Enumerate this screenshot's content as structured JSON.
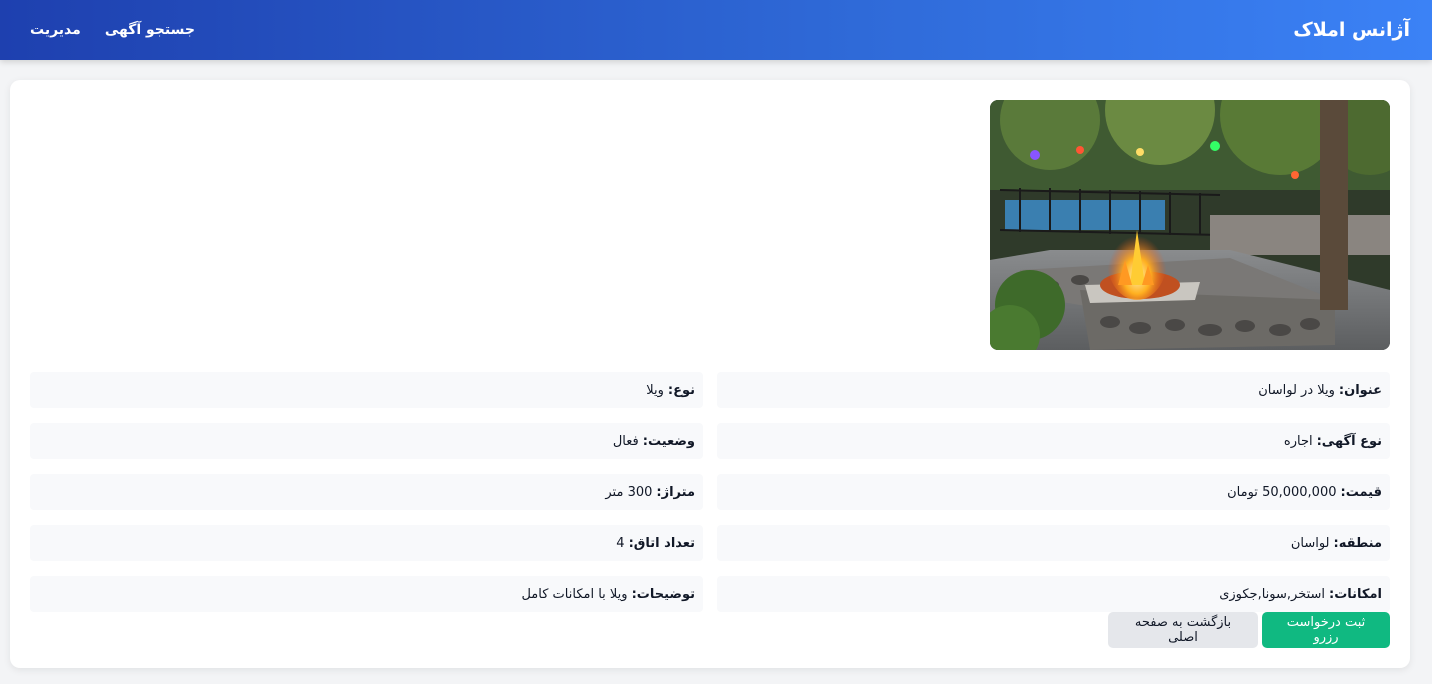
{
  "header": {
    "brand": "آژانس املاک",
    "nav": [
      {
        "label": "جستجو آگهی"
      },
      {
        "label": "مدیریت"
      }
    ]
  },
  "listing": {
    "fields": [
      {
        "label": "عنوان:",
        "value": "ویلا در لواسان"
      },
      {
        "label": "نوع:",
        "value": "ویلا"
      },
      {
        "label": "نوع آگهی:",
        "value": "اجاره"
      },
      {
        "label": "وضعیت:",
        "value": "فعال"
      },
      {
        "label": "قیمت:",
        "value": "50,000,000 تومان"
      },
      {
        "label": "متراژ:",
        "value": "300 متر"
      },
      {
        "label": "منطقه:",
        "value": "لواسان"
      },
      {
        "label": "تعداد اتاق:",
        "value": "4"
      },
      {
        "label": "امکانات:",
        "value": "استخر,سونا,جکوزی"
      },
      {
        "label": "توضیحات:",
        "value": "ویلا با امکانات کامل"
      }
    ]
  },
  "actions": {
    "reserve_label": "ثبت درخواست رزرو",
    "back_label": "بازگشت به صفحه اصلی"
  },
  "colors": {
    "header_start": "#3b82f6",
    "header_end": "#1e40af",
    "primary": "#10b981",
    "secondary": "#e5e7eb"
  }
}
